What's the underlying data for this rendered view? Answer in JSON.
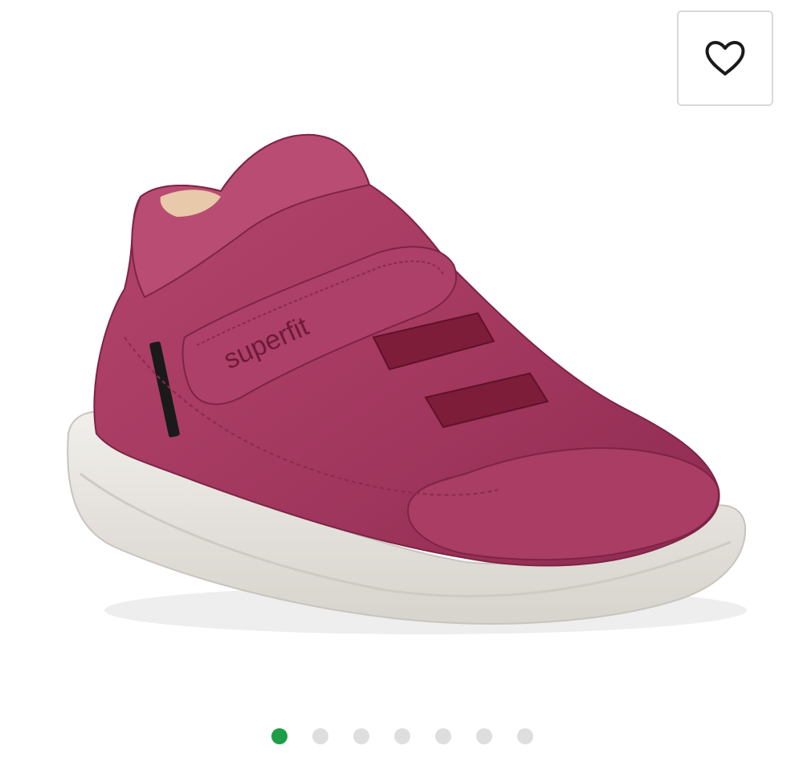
{
  "product_image": {
    "alt": "superfit",
    "brand_mark": "superfit"
  },
  "wishlist": {
    "icon": "heart-outline-icon",
    "color": "#1a1a1a"
  },
  "colors": {
    "shoe_upper": "#a3385f",
    "shoe_sole": "#e7e4df",
    "strap_elastic": "#7d1d3a",
    "active_dot": "#1e9e46",
    "inactive_dot": "#dedede"
  },
  "pagination": {
    "total": 7,
    "active_index": 0
  }
}
